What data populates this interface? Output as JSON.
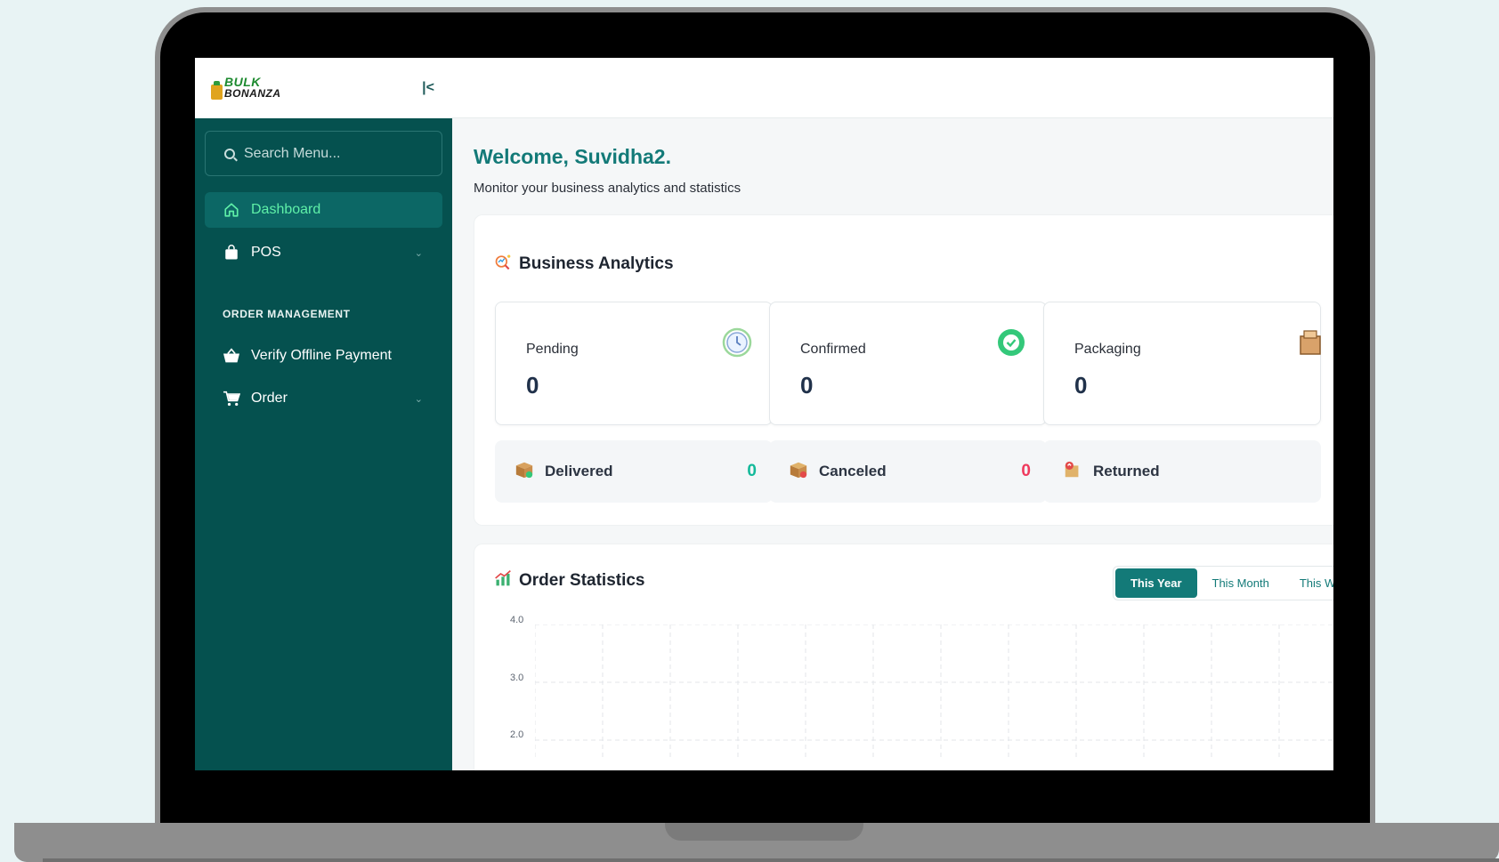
{
  "sidebar": {
    "logo_line1": "BULK",
    "logo_line2": "BONANZA",
    "search_placeholder": "Search Menu...",
    "items": [
      {
        "label": "Dashboard",
        "icon": "home-icon",
        "active": true
      },
      {
        "label": "POS",
        "icon": "shopping-bag-icon",
        "has_submenu": true
      }
    ],
    "section_order_management": "ORDER MANAGEMENT",
    "order_items": [
      {
        "label": "Verify Offline Payment",
        "icon": "basket-icon"
      },
      {
        "label": "Order",
        "icon": "cart-icon",
        "has_submenu": true
      }
    ]
  },
  "main": {
    "welcome": "Welcome, Suvidha2.",
    "subtitle": "Monitor your business analytics and statistics"
  },
  "analytics": {
    "title": "Business Analytics",
    "cards": [
      {
        "label": "Pending",
        "value": "0",
        "icon": "clock-icon"
      },
      {
        "label": "Confirmed",
        "value": "0",
        "icon": "check-circle-icon"
      },
      {
        "label": "Packaging",
        "value": "0",
        "icon": "package-icon"
      }
    ],
    "mini": [
      {
        "label": "Delivered",
        "value": "0",
        "icon": "box-icon",
        "color": "#13b99a"
      },
      {
        "label": "Canceled",
        "value": "0",
        "icon": "box-cancel-icon",
        "color": "#ef3a5d"
      },
      {
        "label": "Returned",
        "value": "",
        "icon": "return-box-icon"
      }
    ]
  },
  "order_statistics": {
    "title": "Order Statistics",
    "tabs": [
      "This Year",
      "This Month",
      "This Week"
    ],
    "active_tab": "This Year",
    "y_ticks": [
      "4.0",
      "3.0",
      "2.0"
    ]
  },
  "colors": {
    "sidebar_bg": "#05514f",
    "accent": "#137a78",
    "active_nav_text": "#5ff0a8"
  }
}
